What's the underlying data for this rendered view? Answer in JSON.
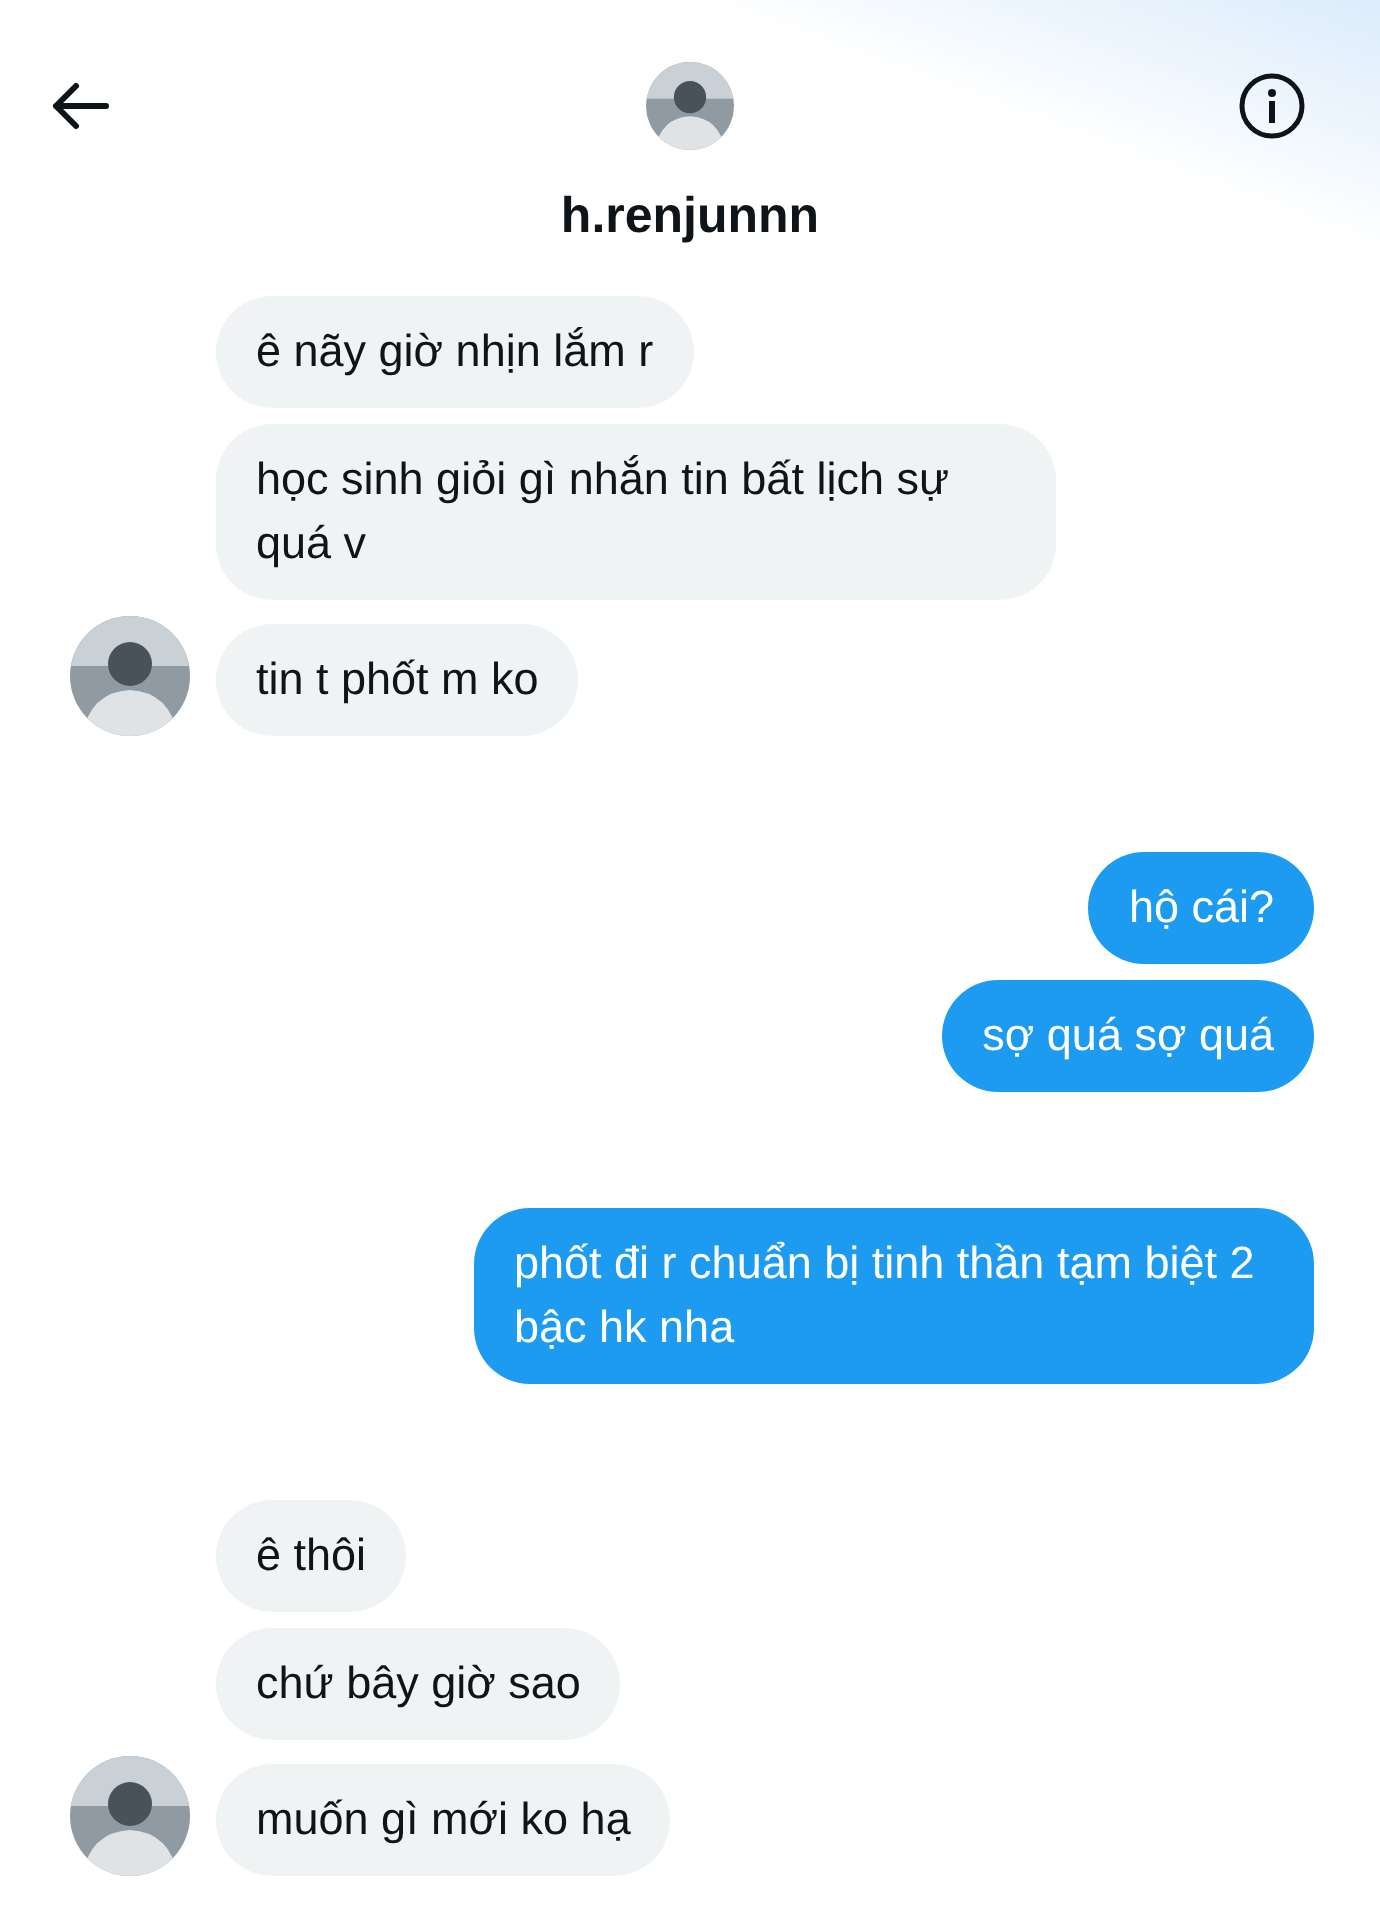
{
  "header": {
    "title": "h.renjunnn"
  },
  "groups": [
    {
      "kind": "incoming",
      "messages": [
        "ê nãy giờ nhịn lắm r",
        "học sinh giỏi gì nhắn tin bất lịch sự quá v",
        "tin t phốt m ko"
      ]
    },
    {
      "kind": "outgoing",
      "messages": [
        "hộ cái?",
        "sợ quá sợ quá"
      ]
    },
    {
      "kind": "outgoing",
      "messages": [
        "phốt đi r chuẩn bị tinh thần tạm biệt 2 bậc hk nha"
      ]
    },
    {
      "kind": "incoming",
      "messages": [
        "ê thôi",
        "chứ bây giờ sao",
        "muốn gì mới ko hạ"
      ]
    }
  ]
}
